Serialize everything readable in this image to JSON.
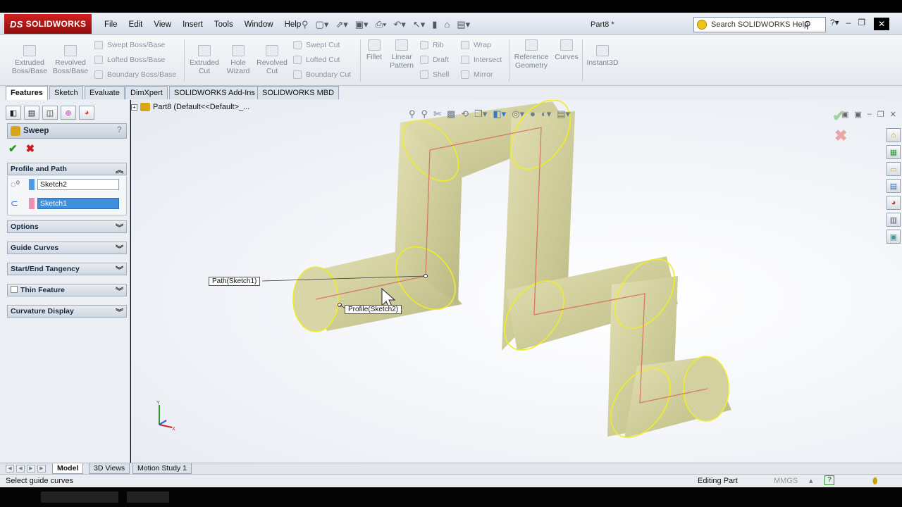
{
  "app": {
    "logo_text": "SOLIDWORKS",
    "logo_prefix": "DS",
    "doc_title": "Part8 *"
  },
  "menu": [
    "File",
    "Edit",
    "View",
    "Insert",
    "Tools",
    "Window",
    "Help"
  ],
  "search": {
    "placeholder": "Search SOLIDWORKS Help"
  },
  "ribbon": {
    "extruded_boss": [
      "Extruded",
      "Boss/Base"
    ],
    "revolved_boss": [
      "Revolved",
      "Boss/Base"
    ],
    "swept_boss": "Swept Boss/Base",
    "lofted_boss": "Lofted Boss/Base",
    "boundary_boss": "Boundary Boss/Base",
    "extruded_cut": [
      "Extruded",
      "Cut"
    ],
    "hole_wizard": [
      "Hole",
      "Wizard"
    ],
    "revolved_cut": [
      "Revolved",
      "Cut"
    ],
    "swept_cut": "Swept Cut",
    "lofted_cut": "Lofted Cut",
    "boundary_cut": "Boundary Cut",
    "fillet": "Fillet",
    "linear_pattern": [
      "Linear",
      "Pattern"
    ],
    "rib": "Rib",
    "draft": "Draft",
    "shell": "Shell",
    "wrap": "Wrap",
    "intersect": "Intersect",
    "mirror": "Mirror",
    "reference_geometry": [
      "Reference",
      "Geometry"
    ],
    "curves": "Curves",
    "instant3d": "Instant3D"
  },
  "command_tabs": [
    "Features",
    "Sketch",
    "Evaluate",
    "DimXpert",
    "SOLIDWORKS Add-Ins",
    "SOLIDWORKS MBD"
  ],
  "property_manager": {
    "title": "Sweep",
    "help": "?",
    "profile_and_path": "Profile and Path",
    "profile_value": "Sketch2",
    "path_value": "Sketch1",
    "options": "Options",
    "guide_curves": "Guide Curves",
    "start_end_tangency": "Start/End Tangency",
    "thin_feature": "Thin Feature",
    "curvature_display": "Curvature Display"
  },
  "viewport": {
    "tree_root": "Part8  (Default<<Default>_...",
    "callout_path": "Path(Sketch1)",
    "callout_profile": "Profile(Sketch2)",
    "triad_y": "Y",
    "triad_x": "X",
    "colors": {
      "tube_fill": "#cfcd9a",
      "edge": "#f0ec2a",
      "sketch": "#d9665e"
    }
  },
  "bottom_tabs": [
    "Model",
    "3D Views",
    "Motion Study 1"
  ],
  "status": {
    "message": "Select guide curves",
    "mode": "Editing Part",
    "units": "MMGS"
  }
}
